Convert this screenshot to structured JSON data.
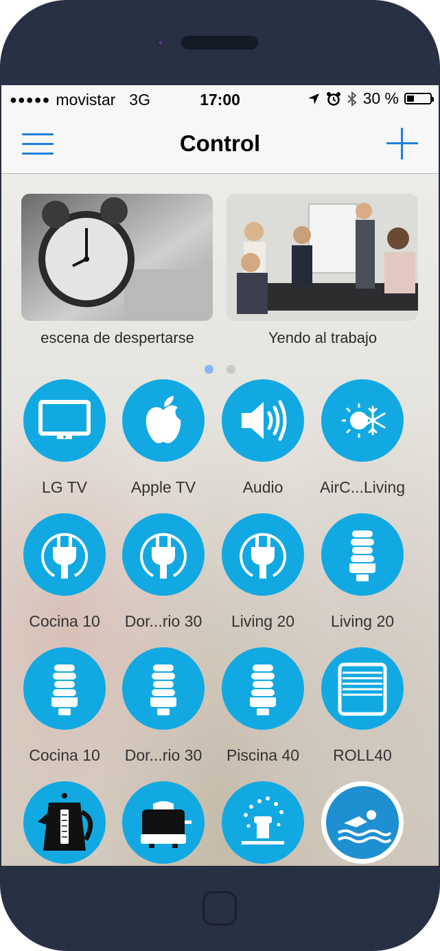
{
  "status_bar": {
    "signal": "●●●●●",
    "carrier": "movistar",
    "network": "3G",
    "time": "17:00",
    "battery": "30 %",
    "battery_level": 0.3
  },
  "nav": {
    "title": "Control"
  },
  "scenes": [
    {
      "label": "escena de despertarse",
      "image": "alarm-clock-photo"
    },
    {
      "label": "Yendo al trabajo",
      "image": "business-meeting-photo"
    }
  ],
  "pager": {
    "active_page": 1,
    "total_pages": 2,
    "active_color": "#8ab4f3",
    "inactive_color": "#c8c8c8"
  },
  "colors": {
    "accent": "#1e7fe0",
    "tile": "#12a9e2"
  },
  "devices": [
    {
      "label": "LG TV",
      "icon": "tv-icon"
    },
    {
      "label": "Apple TV",
      "icon": "apple-icon"
    },
    {
      "label": "Audio",
      "icon": "speaker-icon"
    },
    {
      "label": "AirC...Living",
      "icon": "air-conditioner-icon"
    },
    {
      "label": "Cocina 10",
      "icon": "power-plug-icon"
    },
    {
      "label": "Dor...rio 30",
      "icon": "power-plug-icon"
    },
    {
      "label": "Living 20",
      "icon": "power-plug-icon"
    },
    {
      "label": "Living 20",
      "icon": "light-bulb-icon"
    },
    {
      "label": "Cocina 10",
      "icon": "light-bulb-icon"
    },
    {
      "label": "Dor...rio 30",
      "icon": "light-bulb-icon"
    },
    {
      "label": "Piscina 40",
      "icon": "light-bulb-icon"
    },
    {
      "label": "ROLL40",
      "icon": "roller-blind-icon"
    },
    {
      "label": "",
      "icon": "kettle-icon"
    },
    {
      "label": "",
      "icon": "toaster-icon"
    },
    {
      "label": "",
      "icon": "sprinkler-icon"
    },
    {
      "label": "",
      "icon": "pool-swimmer-icon"
    }
  ]
}
